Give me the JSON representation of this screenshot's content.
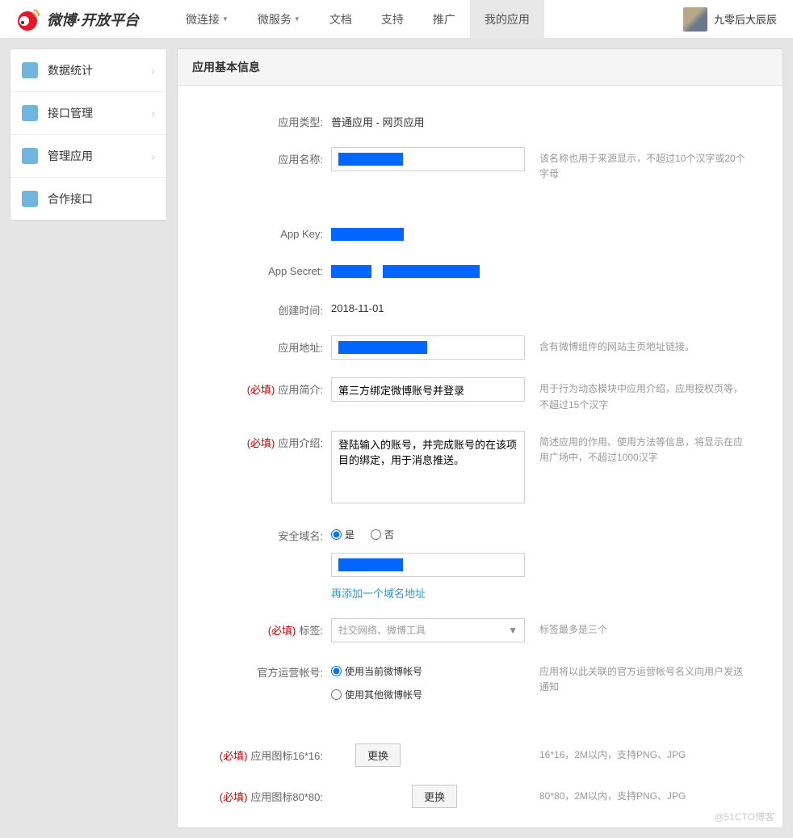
{
  "logo": {
    "text": "微博·开放平台"
  },
  "nav": {
    "items": [
      {
        "label": "微连接",
        "caret": true
      },
      {
        "label": "微服务",
        "caret": true
      },
      {
        "label": "文档",
        "caret": false
      },
      {
        "label": "支持",
        "caret": false
      },
      {
        "label": "推广",
        "caret": false
      },
      {
        "label": "我的应用",
        "caret": false,
        "active": true
      }
    ]
  },
  "user": {
    "name": "九零后大辰辰"
  },
  "sidebar": {
    "items": [
      {
        "label": "数据统计",
        "icon": "chart",
        "arrow": true
      },
      {
        "label": "接口管理",
        "icon": "plug",
        "arrow": true
      },
      {
        "label": "管理应用",
        "icon": "stack",
        "arrow": true
      },
      {
        "label": "合作接口",
        "icon": "sliders",
        "arrow": false
      }
    ]
  },
  "panel": {
    "title": "应用基本信息"
  },
  "form": {
    "required_label": "(必填)",
    "app_type": {
      "label": "应用类型:",
      "value": "普通应用  -  网页应用"
    },
    "app_name": {
      "label": "应用名称:",
      "value": "████████",
      "help": "该名称也用于来源显示，不超过10个汉字或20个字母"
    },
    "app_key": {
      "label": "App Key:",
      "value": "██████████"
    },
    "app_secret": {
      "label": "App Secret:",
      "value": "████████████████████████████"
    },
    "create_time": {
      "label": "创建时间:",
      "value": "2018-11-01"
    },
    "app_url": {
      "label": "应用地址:",
      "value": "████████████████",
      "help": "含有微博组件的网站主页地址链接。"
    },
    "app_brief": {
      "label": "应用简介:",
      "value": "第三方绑定微博账号并登录",
      "help": "用于行为动态模块中应用介绍，应用授权页等，不超过15个汉字"
    },
    "app_desc": {
      "label": "应用介绍:",
      "value": "登陆输入的账号，并完成账号的在该项目的绑定，用于消息推送。",
      "help": "简述应用的作用、使用方法等信息，将显示在应用广场中，不超过1000汉字"
    },
    "safe_domain": {
      "label": "安全域名:",
      "yes": "是",
      "no": "否",
      "value": "██████████",
      "add_link": "再添加一个域名地址"
    },
    "tags": {
      "label": "标签:",
      "placeholder": "社交网络、微博工具",
      "help": "标签最多是三个"
    },
    "official": {
      "label": "官方运营帐号:",
      "opt1": "使用当前微博帐号",
      "opt2": "使用其他微博帐号",
      "help": "应用将以此关联的官方运营帐号名义向用户发送通知"
    },
    "icon16": {
      "label": "应用图标16*16:",
      "btn": "更换",
      "help": "16*16，2M以内，支持PNG、JPG"
    },
    "icon80": {
      "label": "应用图标80*80:",
      "btn": "更换",
      "help": "80*80，2M以内，支持PNG、JPG"
    }
  },
  "watermark": "@51CTO博客"
}
